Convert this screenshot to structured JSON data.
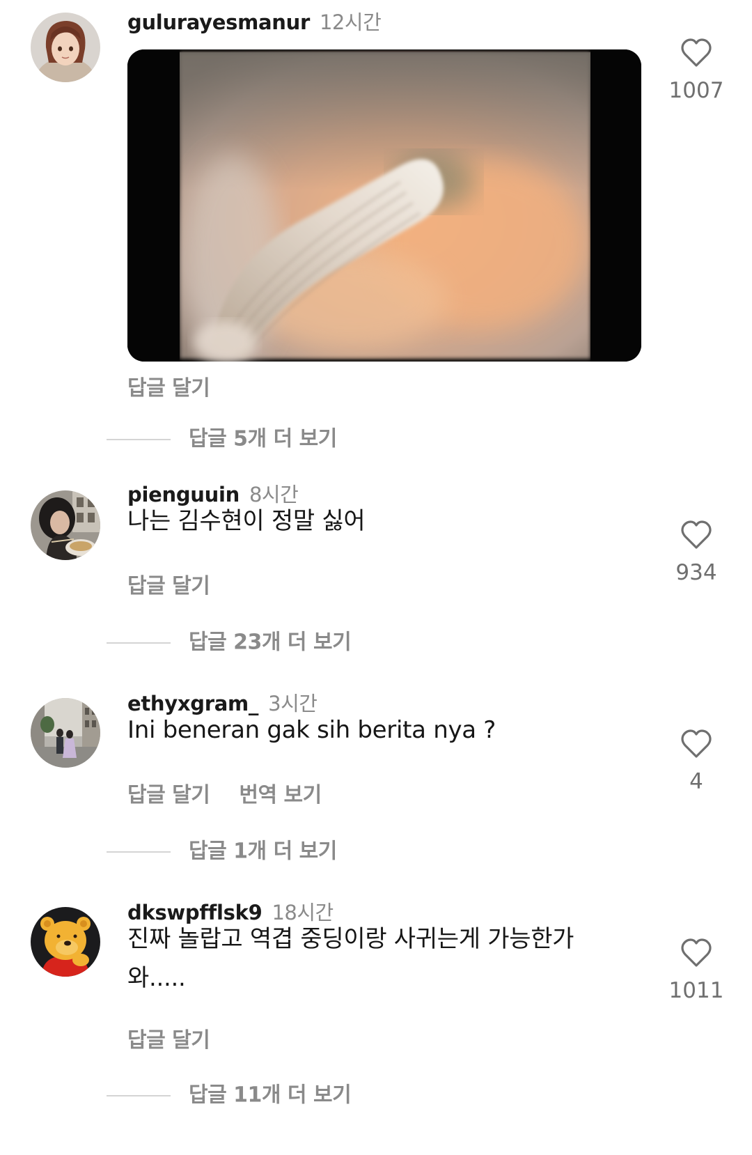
{
  "comments": [
    {
      "username": "gulurayesmanur",
      "time": "12시간",
      "text": "",
      "media": "gif-image",
      "reply_label": "답글 달기",
      "like_count": "1007",
      "more_replies": "답글 5개 더 보기"
    },
    {
      "username": "pienguuin",
      "time": "8시간",
      "text": "나는 김수현이 정말 싫어",
      "reply_label": "답글 달기",
      "like_count": "934",
      "more_replies": "답글 23개 더 보기"
    },
    {
      "username": "ethyxgram_",
      "time": "3시간",
      "text": "Ini beneran gak sih berita nya ?",
      "reply_label": "답글 달기",
      "translate_label": "번역 보기",
      "like_count": "4",
      "more_replies": "답글 1개 더 보기"
    },
    {
      "username": "dkswpfflsk9",
      "time": "18시간",
      "text": "진짜 놀랍고 역겹 중딩이랑 사귀는게 가능한가 와.....",
      "reply_label": "답글 달기",
      "like_count": "1011",
      "more_replies": "답글 11개 더 보기"
    }
  ],
  "icons": {
    "like": "heart-outline-icon"
  },
  "colors": {
    "muted_text": "#8a8a8a",
    "body_text": "#161616",
    "divider": "#d4d4d4"
  }
}
